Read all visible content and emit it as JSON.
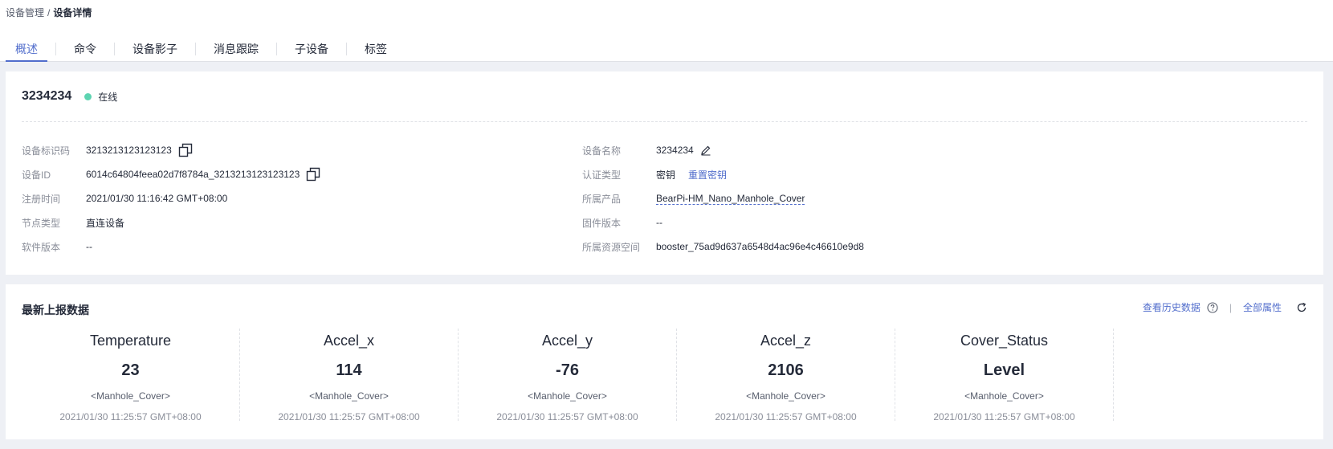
{
  "breadcrumb": {
    "parent": "设备管理",
    "separator": "/",
    "current": "设备详情"
  },
  "tabs": [
    {
      "label": "概述",
      "active": true
    },
    {
      "label": "命令",
      "active": false
    },
    {
      "label": "设备影子",
      "active": false
    },
    {
      "label": "消息跟踪",
      "active": false
    },
    {
      "label": "子设备",
      "active": false
    },
    {
      "label": "标签",
      "active": false
    }
  ],
  "device": {
    "title": "3234234",
    "status": "在线",
    "status_color": "#5dd4b1"
  },
  "info_left": [
    {
      "label": "设备标识码",
      "value": "3213213123123123",
      "copy": true
    },
    {
      "label": "设备ID",
      "value": "6014c64804feea02d7f8784a_3213213123123123",
      "copy": true
    },
    {
      "label": "注册时间",
      "value": "2021/01/30 11:16:42 GMT+08:00"
    },
    {
      "label": "节点类型",
      "value": "直连设备"
    },
    {
      "label": "软件版本",
      "value": "--"
    }
  ],
  "info_right": [
    {
      "label": "设备名称",
      "value": "3234234",
      "editable": true
    },
    {
      "label": "认证类型",
      "value": "密钥",
      "action": "重置密钥"
    },
    {
      "label": "所属产品",
      "value": "BearPi-HM_Nano_Manhole_Cover"
    },
    {
      "label": "固件版本",
      "value": "--"
    },
    {
      "label": "所属资源空间",
      "value": "booster_75ad9d637a6548d4ac96e4c46610e9d8"
    }
  ],
  "latest_data": {
    "title": "最新上报数据",
    "history_link": "查看历史数据",
    "separator": "|",
    "all_props_link": "全部属性",
    "metrics": [
      {
        "name": "Temperature",
        "value": "23",
        "service": "<Manhole_Cover>",
        "time": "2021/01/30 11:25:57 GMT+08:00"
      },
      {
        "name": "Accel_x",
        "value": "114",
        "service": "<Manhole_Cover>",
        "time": "2021/01/30 11:25:57 GMT+08:00"
      },
      {
        "name": "Accel_y",
        "value": "-76",
        "service": "<Manhole_Cover>",
        "time": "2021/01/30 11:25:57 GMT+08:00"
      },
      {
        "name": "Accel_z",
        "value": "2106",
        "service": "<Manhole_Cover>",
        "time": "2021/01/30 11:25:57 GMT+08:00"
      },
      {
        "name": "Cover_Status",
        "value": "Level",
        "service": "<Manhole_Cover>",
        "time": "2021/01/30 11:25:57 GMT+08:00"
      }
    ]
  },
  "colors": {
    "accent": "#526ecc",
    "text": "#252b3a",
    "muted": "#8a8e99",
    "background": "#eef0f5"
  },
  "icons": {
    "copy": "copy-icon",
    "edit": "edit-icon",
    "help": "help-icon",
    "refresh": "refresh-icon"
  }
}
